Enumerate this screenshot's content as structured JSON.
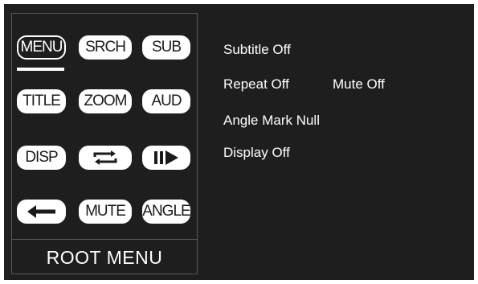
{
  "menu": {
    "title": "ROOT MENU",
    "selected": "MENU",
    "buttons": {
      "menu": "MENU",
      "search": "SRCH",
      "subtitle": "SUB",
      "title": "TITLE",
      "zoom": "ZOOM",
      "audio": "AUD",
      "display": "DISP",
      "repeat_icon": "repeat-icon",
      "step_icon": "step-forward-icon",
      "back_icon": "back-arrow-icon",
      "mute": "MUTE",
      "angle": "ANGLE"
    }
  },
  "status": {
    "subtitle": "Subtitle Off",
    "repeat": "Repeat Off",
    "mute": "Mute Off",
    "angle_mark": "Angle Mark Null",
    "display": "Display Off"
  },
  "colors": {
    "background": "#1e1e1e",
    "button": "#ffffff",
    "text": "#ffffff"
  }
}
